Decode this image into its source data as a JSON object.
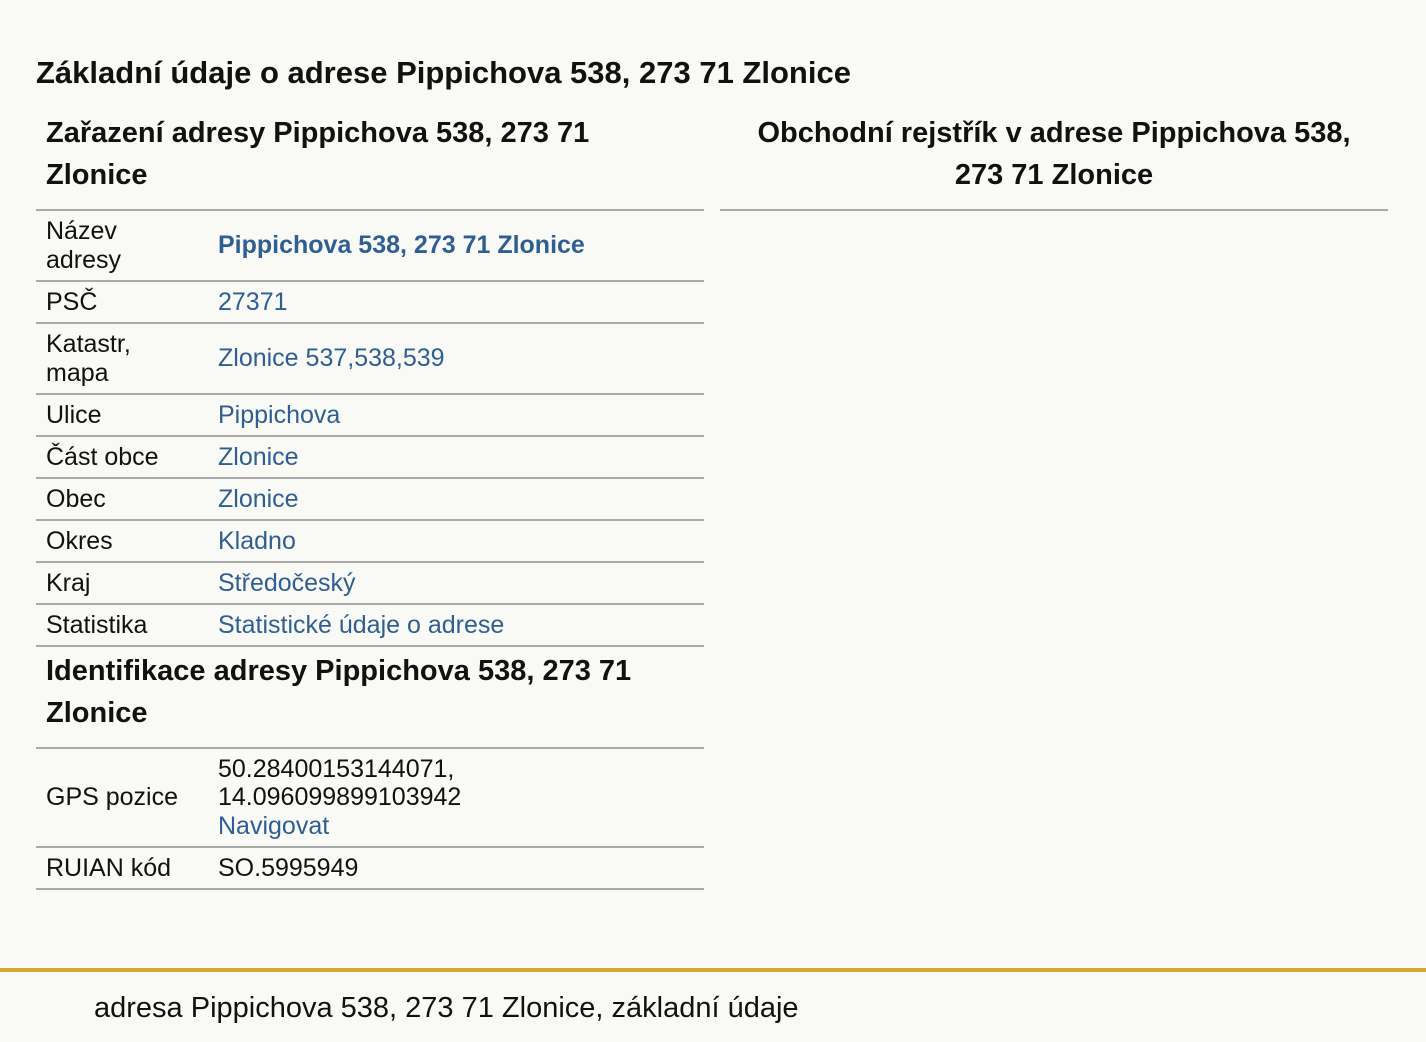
{
  "page_title": "Základní údaje o adrese Pippichova 538, 273 71 Zlonice",
  "classification": {
    "heading": "Zařazení adresy Pippichova 538, 273 71 Zlonice",
    "rows": [
      {
        "label": "Název adresy",
        "value": "Pippichova 538, 273 71 Zlonice"
      },
      {
        "label": "PSČ",
        "value": "27371"
      },
      {
        "label": "Katastr, mapa",
        "value": "Zlonice 537,538,539"
      },
      {
        "label": "Ulice",
        "value": "Pippichova"
      },
      {
        "label": "Část obce",
        "value": "Zlonice"
      },
      {
        "label": "Obec",
        "value": "Zlonice"
      },
      {
        "label": "Okres",
        "value": "Kladno"
      },
      {
        "label": "Kraj",
        "value": "Středočeský"
      },
      {
        "label": "Statistika",
        "value": "Statistické údaje o adrese"
      }
    ]
  },
  "identification": {
    "heading": "Identifikace adresy Pippichova 538, 273 71 Zlonice",
    "gps_label": "GPS pozice",
    "gps_lat": "50.28400153144071,",
    "gps_lon": "14.096099899103942",
    "navigate_label": "Navigovat",
    "ruian_label": "RUIAN kód",
    "ruian_value": "SO.5995949"
  },
  "business_register": {
    "heading": "Obchodní rejstřík v adrese Pippichova 538, 273 71 Zlonice"
  },
  "footer": {
    "text": "adresa Pippichova 538, 273 71 Zlonice, základní údaje"
  },
  "colors": {
    "link": "#2f5e93",
    "footer_accent": "#d4a82e",
    "background": "#f9f9f5"
  }
}
